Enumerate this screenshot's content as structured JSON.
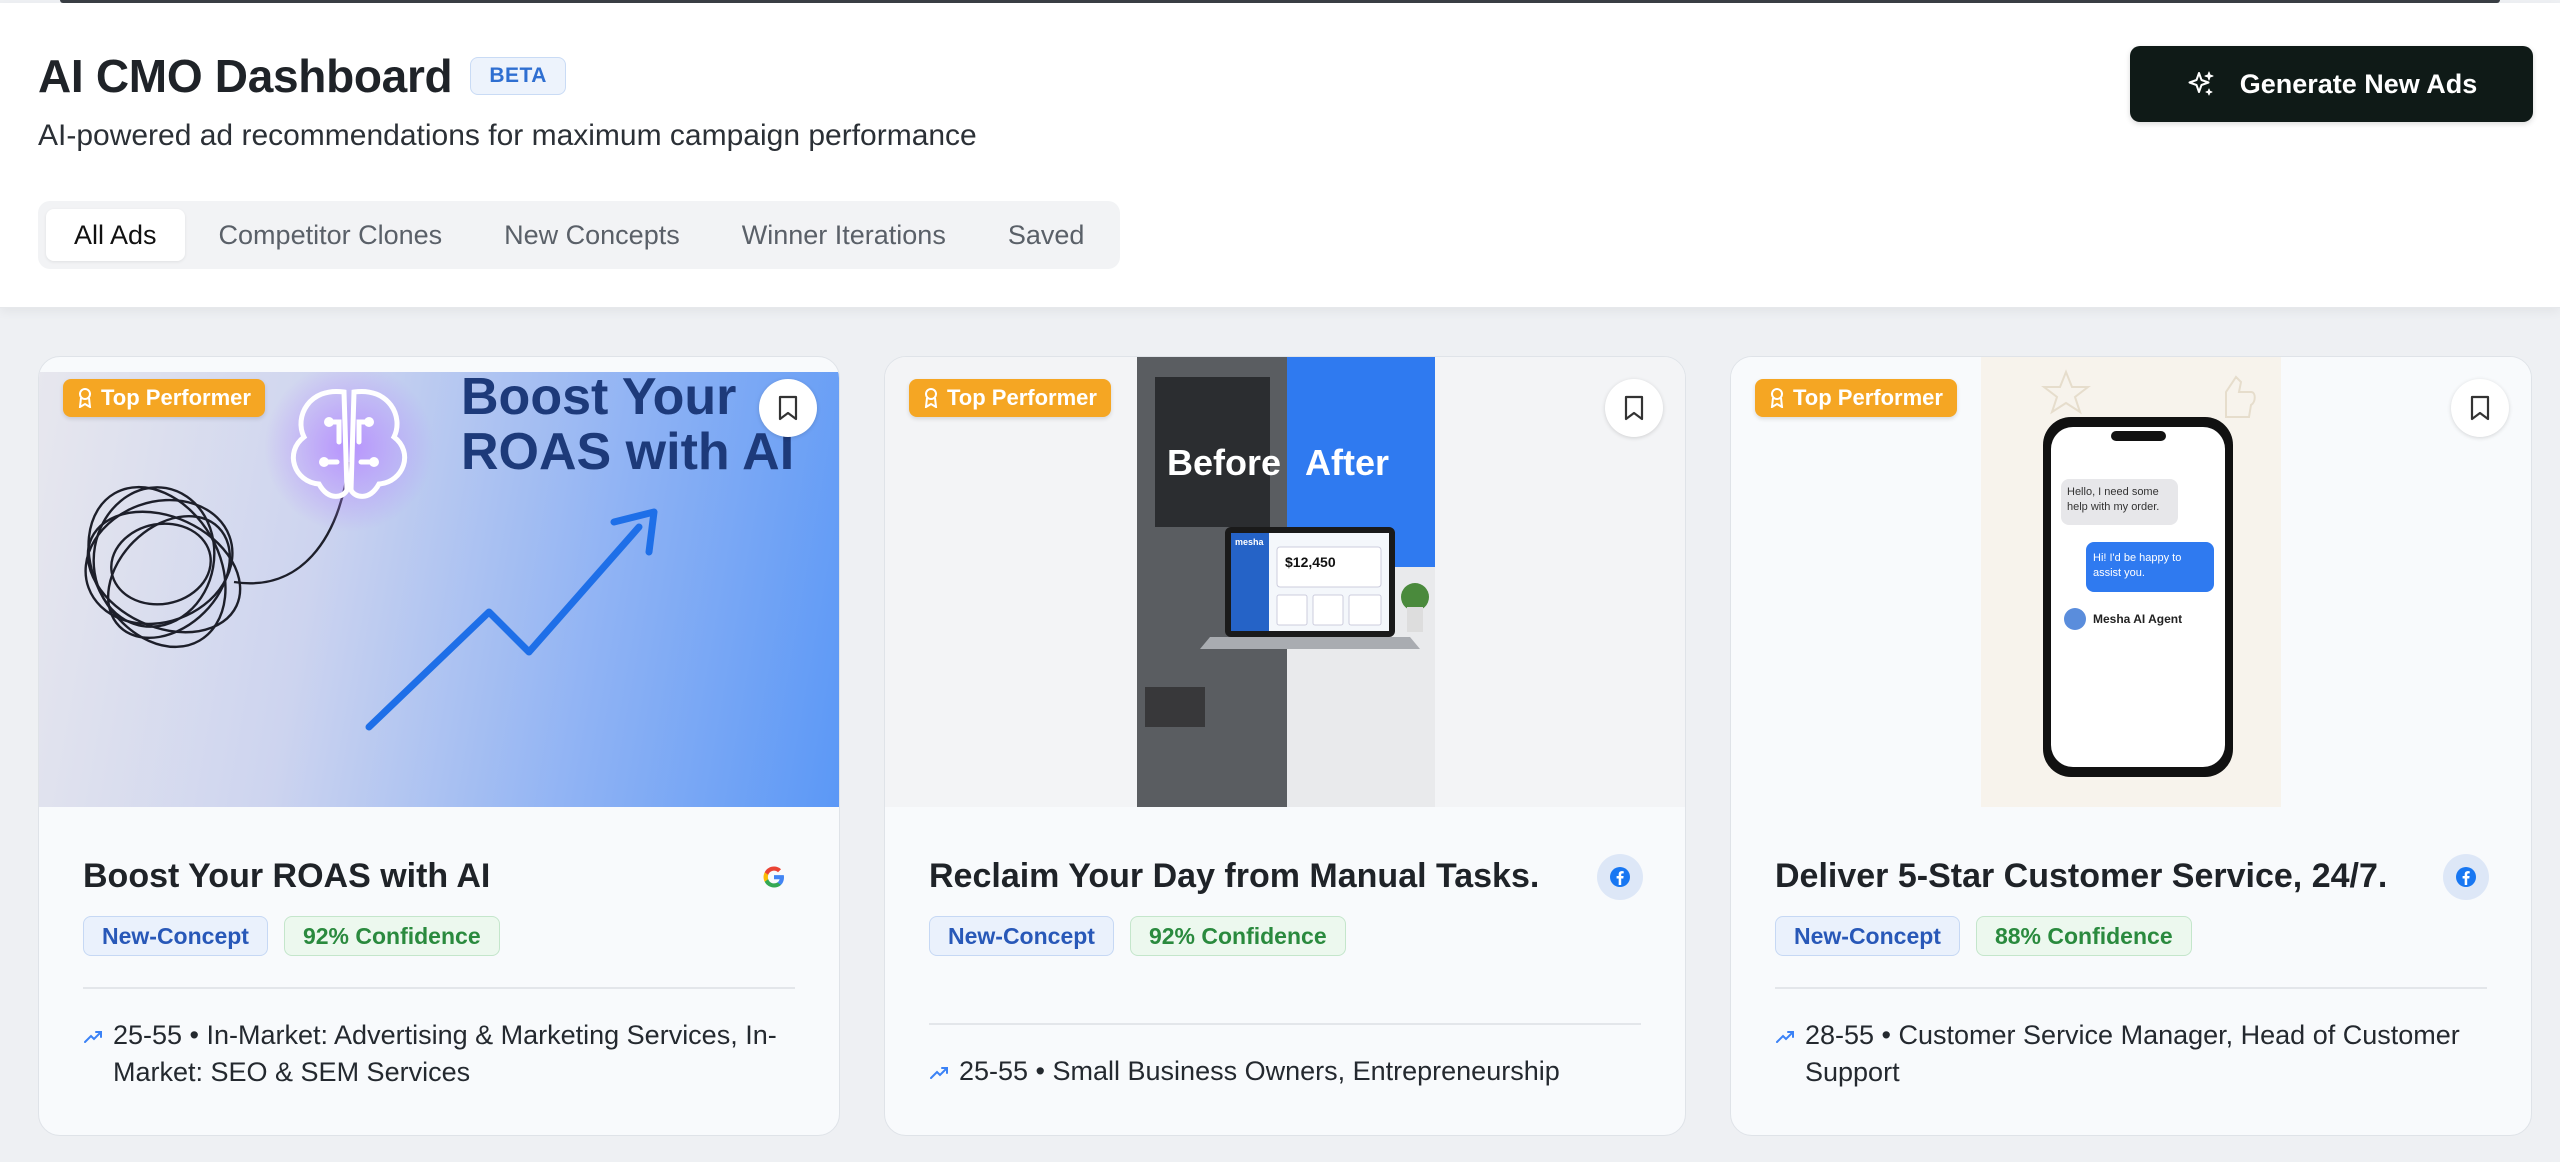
{
  "header": {
    "title": "AI CMO Dashboard",
    "beta": "BETA",
    "subtitle": "AI-powered ad recommendations for maximum campaign performance",
    "generate_button": "Generate New Ads"
  },
  "tabs": [
    {
      "label": "All Ads",
      "active": true
    },
    {
      "label": "Competitor Clones",
      "active": false
    },
    {
      "label": "New Concepts",
      "active": false
    },
    {
      "label": "Winner Iterations",
      "active": false
    },
    {
      "label": "Saved",
      "active": false
    }
  ],
  "cards": [
    {
      "badge": "Top Performer",
      "image_text": {
        "line1": "Boost Your",
        "line2": "ROAS with AI"
      },
      "title": "Boost Your ROAS with AI",
      "platform": "google-icon",
      "tag_type": "New-Concept",
      "confidence": "92% Confidence",
      "audience": "25-55 • In-Market: Advertising & Marketing Services, In-Market: SEO & SEM Services"
    },
    {
      "badge": "Top Performer",
      "image_text": {
        "before": "Before",
        "after": "After",
        "amount": "$12,450",
        "brand": "mesha"
      },
      "title": "Reclaim Your Day from Manual Tasks.",
      "platform": "facebook-icon",
      "tag_type": "New-Concept",
      "confidence": "92% Confidence",
      "audience": "25-55 • Small Business Owners, Entrepreneurship"
    },
    {
      "badge": "Top Performer",
      "image_text": {
        "msg1": "Hello, I need some help with my order.",
        "msg2": "Hi! I'd be happy to assist you.",
        "agent": "Mesha AI Agent"
      },
      "title": "Deliver 5-Star Customer Service, 24/7.",
      "platform": "facebook-icon",
      "tag_type": "New-Concept",
      "confidence": "88% Confidence",
      "audience": "28-55 • Customer Service Manager, Head of Customer Support"
    }
  ],
  "colors": {
    "badge": "#f5a623",
    "primary_button": "#0f1a17",
    "concept_tag": "#2858b8",
    "confidence_tag": "#2a8a3e"
  }
}
